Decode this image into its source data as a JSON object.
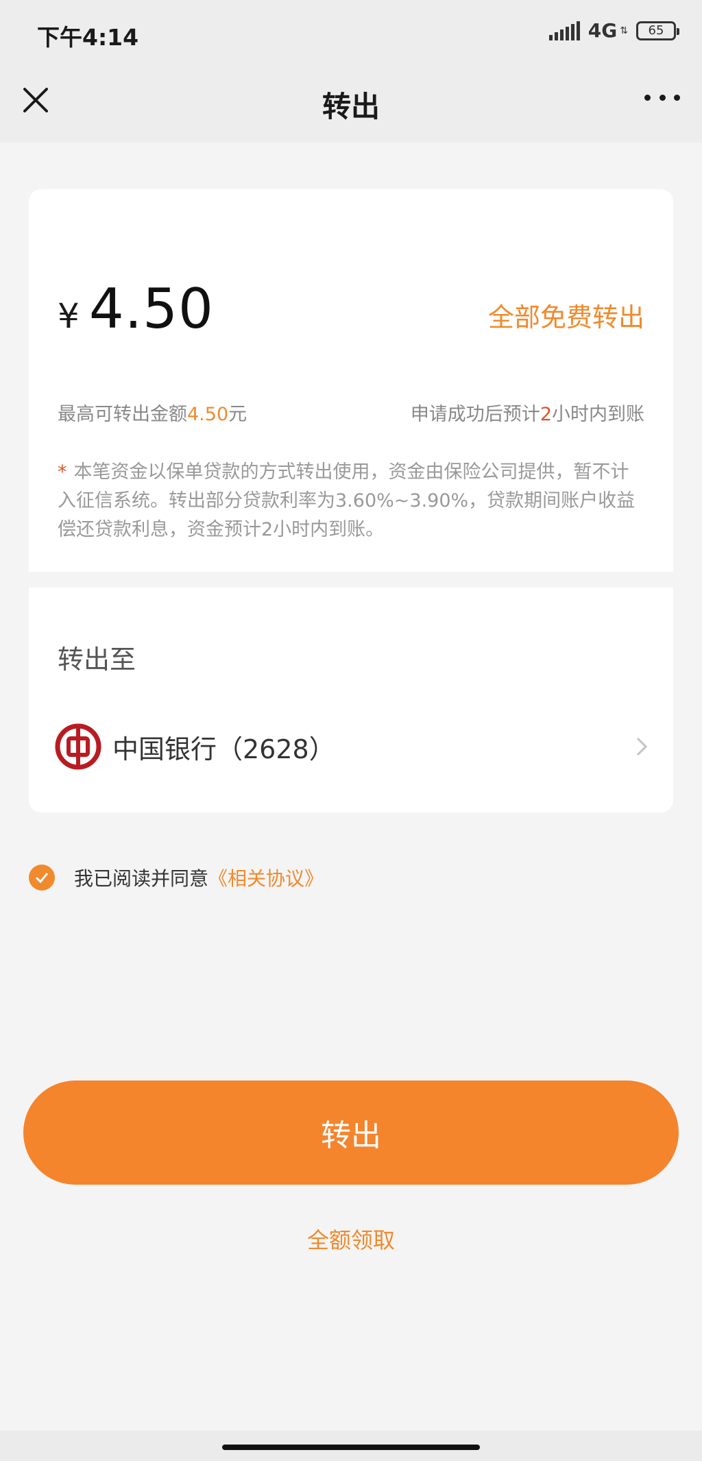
{
  "status_bar": {
    "time": "下午4:14",
    "network": "4G",
    "battery": "65"
  },
  "nav": {
    "title": "转出",
    "close_icon": "close-icon",
    "more_icon": "more-icon"
  },
  "amount_card": {
    "currency": "¥",
    "amount": "4.50",
    "all_free_label": "全部免费转出",
    "max_prefix": "最高可转出金额",
    "max_value": "4.50",
    "max_suffix": "元",
    "eta_prefix": "申请成功后预计",
    "eta_value": "2",
    "eta_suffix": "小时内到账",
    "notice_star": "*",
    "notice": "本笔资金以保单贷款的方式转出使用，资金由保险公司提供，暂不计入征信系统。转出部分贷款利率为3.60%~3.90%，贷款期间账户收益偿还贷款利息，资金预计2小时内到账。"
  },
  "destination": {
    "title": "转出至",
    "bank_name": "中国银行（2628）",
    "bank_icon": "bank-of-china-logo"
  },
  "agreement": {
    "text": "我已阅读并同意",
    "link": "《相关协议》",
    "checked": true
  },
  "actions": {
    "submit_label": "转出",
    "full_claim_label": "全额领取"
  },
  "colors": {
    "accent": "#f4852d",
    "accent_text": "#f08a2d",
    "highlight_red": "#e2532b",
    "background": "#f4f4f4",
    "card": "#ffffff",
    "boc_red": "#b81c22"
  }
}
